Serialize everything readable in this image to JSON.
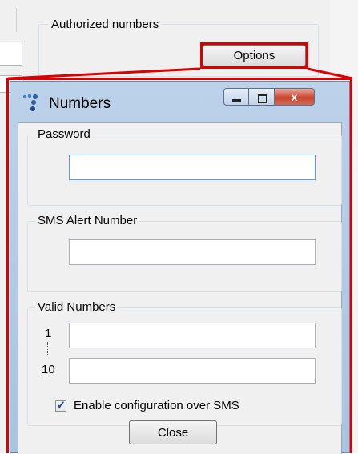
{
  "parent": {
    "group_title": "Authorized numbers",
    "options_label": "Options"
  },
  "dialog": {
    "title": "Numbers",
    "close_glyph": "x",
    "password": {
      "title": "Password",
      "value": ""
    },
    "sms_alert": {
      "title": "SMS Alert Number",
      "value": ""
    },
    "valid_numbers": {
      "title": "Valid Numbers",
      "first_label": "1",
      "last_label": "10",
      "first_value": "",
      "last_value": ""
    },
    "enable_config": {
      "label": "Enable configuration over SMS",
      "checked": true,
      "check_glyph": "✓"
    },
    "close_label": "Close"
  },
  "colors": {
    "highlight": "#d80000",
    "title_bar": "#b5cde8",
    "close_caption": "#c8452e"
  }
}
